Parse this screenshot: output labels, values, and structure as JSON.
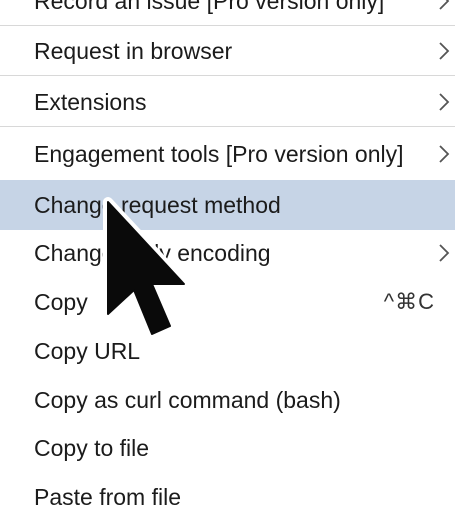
{
  "menu": {
    "items": [
      {
        "label": "Record an issue [Pro version only]",
        "submenu": true
      },
      {
        "label": "Request in browser",
        "submenu": true
      },
      {
        "label": "Extensions",
        "submenu": true
      },
      {
        "label": "Engagement tools [Pro version only]",
        "submenu": true
      },
      {
        "label": "Change request method",
        "submenu": false,
        "highlighted": true
      },
      {
        "label": "Change body encoding",
        "submenu": true
      },
      {
        "label": "Copy",
        "shortcut": "^⌘C"
      },
      {
        "label": "Copy URL"
      },
      {
        "label": "Copy as curl command (bash)"
      },
      {
        "label": "Copy to file"
      },
      {
        "label": "Paste from file"
      }
    ]
  },
  "colors": {
    "highlight": "#c6d4e6",
    "separator": "#d8d8d8",
    "text": "#1b1b1b"
  },
  "icons": {
    "submenu": "chevron-right-icon",
    "pointer": "mouse-cursor-icon"
  }
}
